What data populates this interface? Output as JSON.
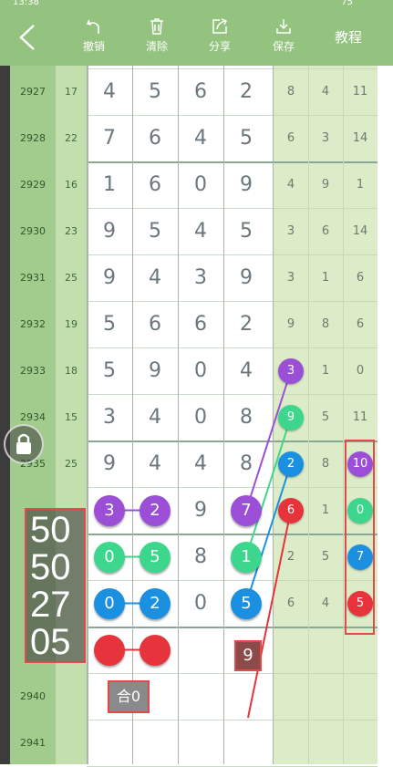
{
  "status_bar": {
    "time": "13:38",
    "battery": "75"
  },
  "toolbar": {
    "undo": "撤销",
    "clear": "清除",
    "share": "分享",
    "save": "保存",
    "tutorial": "教程"
  },
  "rows": [
    {
      "id": "2927",
      "sum": "17",
      "d": [
        "4",
        "5",
        "6",
        "2"
      ],
      "r": [
        "8",
        "4",
        "11"
      ]
    },
    {
      "id": "2928",
      "sum": "22",
      "d": [
        "7",
        "6",
        "4",
        "5"
      ],
      "r": [
        "6",
        "3",
        "14"
      ]
    },
    {
      "id": "2929",
      "sum": "16",
      "d": [
        "1",
        "6",
        "0",
        "9"
      ],
      "r": [
        "4",
        "9",
        "1"
      ]
    },
    {
      "id": "2930",
      "sum": "23",
      "d": [
        "9",
        "5",
        "4",
        "5"
      ],
      "r": [
        "3",
        "6",
        "14"
      ]
    },
    {
      "id": "2931",
      "sum": "25",
      "d": [
        "9",
        "4",
        "3",
        "9"
      ],
      "r": [
        "3",
        "1",
        "6"
      ]
    },
    {
      "id": "2932",
      "sum": "19",
      "d": [
        "5",
        "6",
        "6",
        "2"
      ],
      "r": [
        "9",
        "8",
        "6"
      ]
    },
    {
      "id": "2933",
      "sum": "18",
      "d": [
        "5",
        "9",
        "0",
        "4"
      ],
      "r": [
        "",
        "1",
        "0"
      ]
    },
    {
      "id": "2934",
      "sum": "15",
      "d": [
        "3",
        "4",
        "0",
        "8"
      ],
      "r": [
        "",
        "5",
        "11"
      ]
    },
    {
      "id": "2935",
      "sum": "25",
      "d": [
        "9",
        "4",
        "4",
        "8"
      ],
      "r": [
        "",
        "8",
        ""
      ]
    },
    {
      "id": "",
      "sum": "",
      "d": [
        "",
        "",
        "9",
        ""
      ],
      "r": [
        "",
        "1",
        ""
      ]
    },
    {
      "id": "",
      "sum": "",
      "d": [
        "",
        "",
        "8",
        ""
      ],
      "r": [
        "2",
        "5",
        ""
      ]
    },
    {
      "id": "",
      "sum": "",
      "d": [
        "",
        "",
        "0",
        ""
      ],
      "r": [
        "6",
        "4",
        ""
      ]
    },
    {
      "id": "",
      "sum": "",
      "d": [
        "",
        "",
        "",
        ""
      ],
      "r": [
        "",
        "",
        ""
      ]
    },
    {
      "id": "2940",
      "sum": "",
      "d": [
        "",
        "",
        "",
        ""
      ],
      "r": [
        "",
        "",
        ""
      ]
    },
    {
      "id": "2941",
      "sum": "",
      "d": [
        "",
        "",
        "",
        ""
      ],
      "r": [
        "",
        "",
        ""
      ]
    }
  ],
  "balls": [
    {
      "row": 9,
      "col": 0,
      "label": "3",
      "color": "#9b4fd6"
    },
    {
      "row": 9,
      "col": 1,
      "label": "2",
      "color": "#9b4fd6"
    },
    {
      "row": 9,
      "col": 3,
      "label": "7",
      "color": "#9b4fd6"
    },
    {
      "row": 10,
      "col": 0,
      "label": "0",
      "color": "#3cd68c"
    },
    {
      "row": 10,
      "col": 1,
      "label": "5",
      "color": "#3cd68c"
    },
    {
      "row": 10,
      "col": 3,
      "label": "1",
      "color": "#3cd68c"
    },
    {
      "row": 11,
      "col": 0,
      "label": "0",
      "color": "#1b8fe0"
    },
    {
      "row": 11,
      "col": 1,
      "label": "2",
      "color": "#1b8fe0"
    },
    {
      "row": 11,
      "col": 3,
      "label": "5",
      "color": "#1b8fe0"
    },
    {
      "row": 12,
      "col": 0,
      "label": "",
      "color": "#e6333c"
    },
    {
      "row": 12,
      "col": 1,
      "label": "",
      "color": "#e6333c"
    }
  ],
  "right_balls_left": [
    {
      "row": 6,
      "label": "3",
      "color": "#9b4fd6"
    },
    {
      "row": 7,
      "label": "9",
      "color": "#3cd68c"
    },
    {
      "row": 8,
      "label": "2",
      "color": "#1b8fe0"
    },
    {
      "row": 9,
      "label": "6",
      "color": "#e6333c"
    }
  ],
  "right_balls_right": [
    {
      "row": 8,
      "label": "10",
      "color": "#9b4fd6"
    },
    {
      "row": 9,
      "label": "0",
      "color": "#3cd68c"
    },
    {
      "row": 10,
      "label": "7",
      "color": "#1b8fe0"
    },
    {
      "row": 11,
      "label": "5",
      "color": "#e6333c"
    }
  ],
  "overlay": {
    "big_numbers": [
      "50",
      "50",
      "27",
      "05"
    ],
    "tag_nine": "9",
    "tag_sum": "合0"
  },
  "colors": {
    "toolbar": "#94c37f",
    "id_column": "#a2cc8d",
    "sum_column": "#c4dfae",
    "right_column": "#dcecc8",
    "highlight": "#e24a4a"
  }
}
